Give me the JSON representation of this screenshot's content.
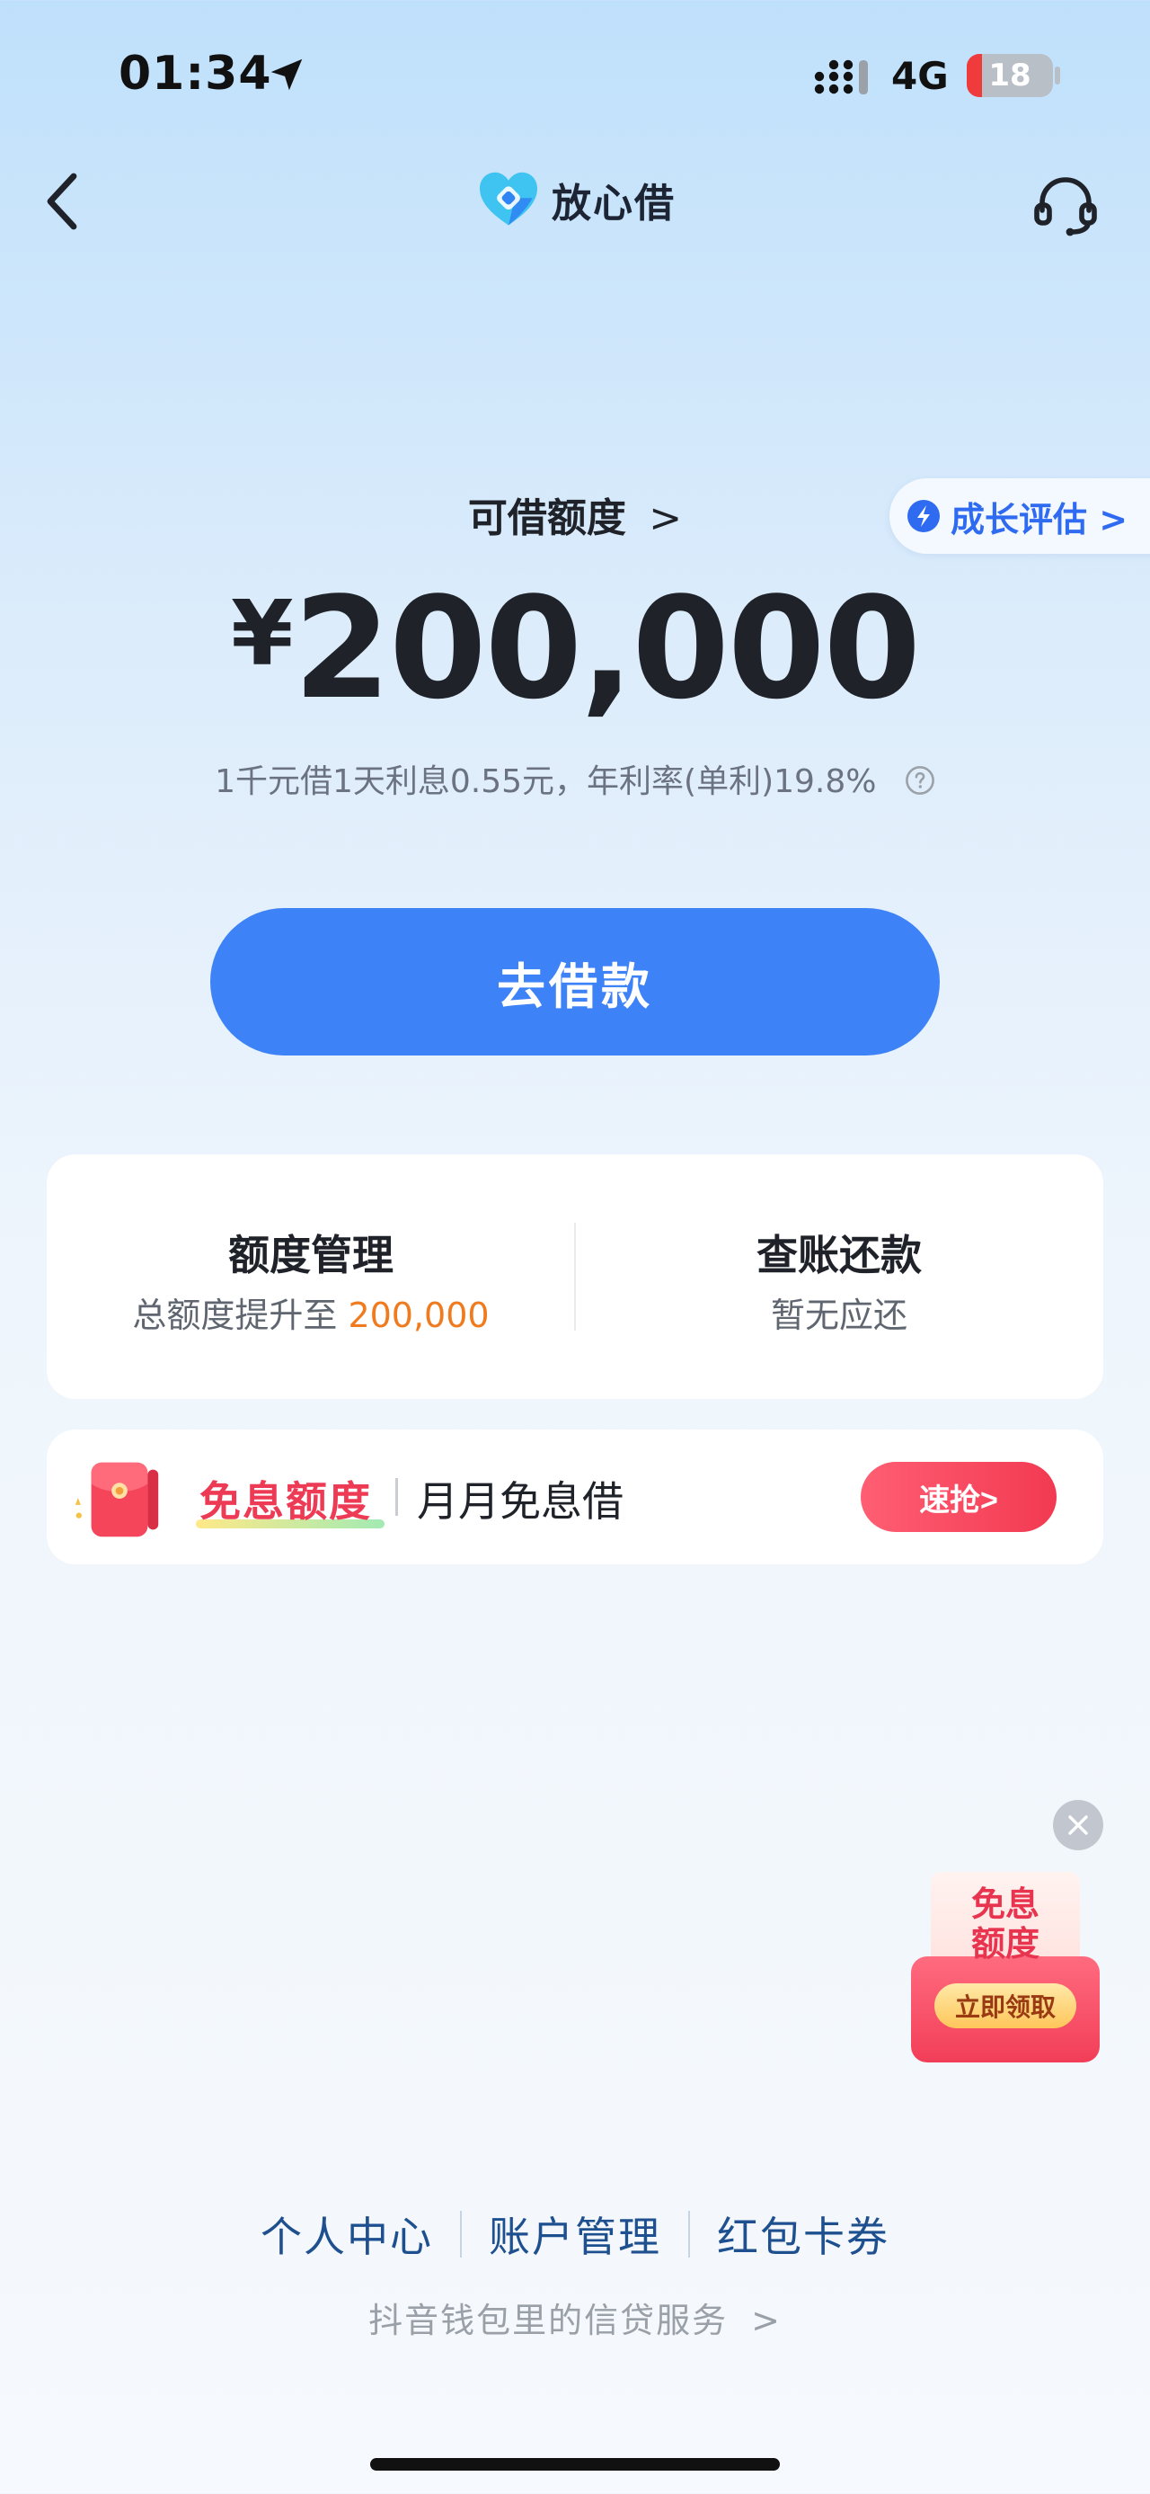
{
  "status_bar": {
    "time": "01:34",
    "network": "4G",
    "battery_level": "18",
    "battery_fraction": 0.18
  },
  "nav": {
    "brand_name": "放心借",
    "back_icon": "chevron-left-icon",
    "support_icon": "headset-icon"
  },
  "credit": {
    "label": "可借额度",
    "label_chevron": ">",
    "currency": "¥",
    "amount": "200,000",
    "rate_text": "1千元借1天利息0.55元，年利率(单利)19.8%",
    "growth_badge": "成长评估 >"
  },
  "actions": {
    "borrow_label": "去借款"
  },
  "quick_card": {
    "limit_title": "额度管理",
    "limit_sub_prefix": "总额度提升至",
    "limit_sub_value": "200,000",
    "repay_title": "查账还款",
    "repay_sub": "暂无应还"
  },
  "promo": {
    "title": "免息额度",
    "desc": "月月免息借",
    "button": "速抢>"
  },
  "float_coupon": {
    "title": "免息\n额度",
    "button": "立即领取"
  },
  "footer": {
    "links": [
      "个人中心",
      "账户管理",
      "红包卡券"
    ],
    "sub": "抖音钱包里的信贷服务",
    "sub_chevron": ">"
  },
  "colors": {
    "primary": "#3d82f7",
    "accent_orange": "#f07a1e",
    "promo_red": "#ee3b55",
    "footer_link": "#1e4f8f"
  }
}
